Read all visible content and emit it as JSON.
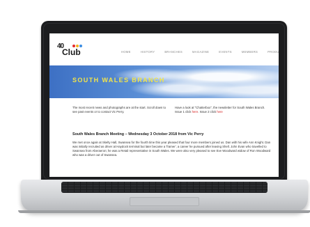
{
  "logo": {
    "forty": "40",
    "club": "Club"
  },
  "nav": {
    "items": [
      "HOME",
      "HISTORY",
      "BRANCHES",
      "MAGAZINE",
      "EVENTS",
      "MEMBERS",
      "PRODUCTS"
    ]
  },
  "banner": {
    "title": "SOUTH WALES BRANCH"
  },
  "intro": {
    "left": "The most recent news and photographs are at the start. Scroll down to see past events or to contact Vic Perry.",
    "right_text": "Have a look at \"Chatterbox\", the newsletter for South Wales Branch.",
    "issue1_prefix": "Issue 1 click ",
    "issue1_link": "here",
    "issue2_prefix": ". Issue 2 click ",
    "issue2_link": "here"
  },
  "article": {
    "title": "South Wales Branch Meeting – Wednesday 3 October 2018 from Vic Perry",
    "body": "We met once again at Skelty Hall, Swansea for the fourth time this year pleased that four more members joined us. Dan with his wife Ann Knight. Dan was initially recruited as driver at Haydock terminal but later became a 'framer', a career he pursued after leaving Shell. John Evan who travelled to Swansea from Aberaeron; he was a Retail representative in South Wales. We were also very pleased to see Eve Woodward widow of Ron Woodward who was a driver out of Swansea."
  },
  "colors": {
    "banner_title": "#f2e44a",
    "link": "#d62020",
    "laptop_frame": "#1c1d1f"
  }
}
